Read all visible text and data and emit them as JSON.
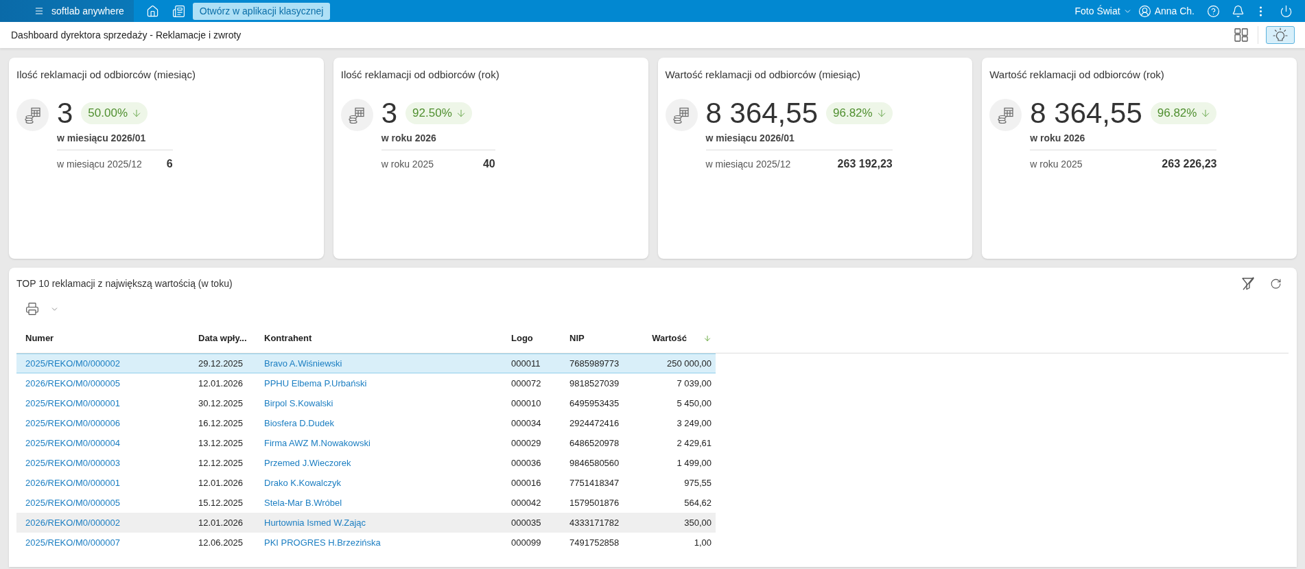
{
  "top_bar": {
    "app_name": "softlab anywhere",
    "open_classic_button": "Otwórz w aplikacji klasycznej",
    "company": "Foto Świat",
    "user": "Anna Ch."
  },
  "page_header": {
    "title": "Dashboard dyrektora sprzedaży - Reklamacje i zwroty",
    "bulb_button": {
      "selected": true
    }
  },
  "kpi_cards": [
    {
      "title": "Ilość reklamacji od odbiorców (miesiąc)",
      "value": "3",
      "change": "50.00%",
      "decreasing": true,
      "period": "w miesiącu 2026/01",
      "previous_period": "w miesiącu 2025/12",
      "previous_value": "6"
    },
    {
      "title": "Ilość reklamacji od odbiorców (rok)",
      "value": "3",
      "change": "92.50%",
      "decreasing": true,
      "period": "w roku 2026",
      "previous_period": "w roku 2025",
      "previous_value": "40"
    },
    {
      "title": "Wartość reklamacji od odbiorców (miesiąc)",
      "value": "8 364,55",
      "change": "96.82%",
      "decreasing": true,
      "period": "w miesiącu 2026/01",
      "previous_period": "w miesiącu 2025/12",
      "previous_value": "263 192,23"
    },
    {
      "title": "Wartość reklamacji od odbiorców (rok)",
      "value": "8 364,55",
      "change": "96.82%",
      "decreasing": true,
      "period": "w roku 2026",
      "previous_period": "w roku 2025",
      "previous_value": "263 226,23"
    }
  ],
  "table": {
    "title": "TOP 10 reklamacji z największą wartością (w toku)",
    "columns": [
      {
        "label": "Numer",
        "kind": "link",
        "sorted": false
      },
      {
        "label": "Data wpły...",
        "kind": "text",
        "sorted": false
      },
      {
        "label": "Kontrahent",
        "kind": "link",
        "sorted": false
      },
      {
        "label": "Logo",
        "kind": "text",
        "sorted": false
      },
      {
        "label": "NIP",
        "kind": "text",
        "sorted": false
      },
      {
        "label": "Wartość",
        "kind": "number",
        "sorted": true
      }
    ],
    "rows": [
      {
        "cells": [
          "2025/REKO/M0/000002",
          "29.12.2025",
          "Bravo A.Wiśniewski",
          "000011",
          "7685989773",
          "250 000,00"
        ],
        "selected": true,
        "hovered": false
      },
      {
        "cells": [
          "2026/REKO/M0/000005",
          "12.01.2026",
          "PPHU Elbema P.Urbański",
          "000072",
          "9818527039",
          "7 039,00"
        ],
        "selected": false,
        "hovered": false
      },
      {
        "cells": [
          "2025/REKO/M0/000001",
          "30.12.2025",
          "Birpol S.Kowalski",
          "000010",
          "6495953435",
          "5 450,00"
        ],
        "selected": false,
        "hovered": false
      },
      {
        "cells": [
          "2025/REKO/M0/000006",
          "16.12.2025",
          "Biosfera D.Dudek",
          "000034",
          "2924472416",
          "3 249,00"
        ],
        "selected": false,
        "hovered": false
      },
      {
        "cells": [
          "2025/REKO/M0/000004",
          "13.12.2025",
          "Firma AWZ M.Nowakowski",
          "000029",
          "6486520978",
          "2 429,61"
        ],
        "selected": false,
        "hovered": false
      },
      {
        "cells": [
          "2025/REKO/M0/000003",
          "12.12.2025",
          "Przemed J.Wieczorek",
          "000036",
          "9846580560",
          "1 499,00"
        ],
        "selected": false,
        "hovered": false
      },
      {
        "cells": [
          "2026/REKO/M0/000001",
          "12.01.2026",
          "Drako K.Kowalczyk",
          "000016",
          "7751418347",
          "975,55"
        ],
        "selected": false,
        "hovered": false
      },
      {
        "cells": [
          "2025/REKO/M0/000005",
          "15.12.2025",
          "Stela-Mar B.Wróbel",
          "000042",
          "1579501876",
          "564,62"
        ],
        "selected": false,
        "hovered": false
      },
      {
        "cells": [
          "2026/REKO/M0/000002",
          "12.01.2026",
          "Hurtownia Ismed W.Zając",
          "000035",
          "4333171782",
          "350,00"
        ],
        "selected": false,
        "hovered": true
      },
      {
        "cells": [
          "2025/REKO/M0/000007",
          "12.06.2025",
          "PKI PROGRES H.Brzezińska",
          "000099",
          "7491752858",
          "1,00"
        ],
        "selected": false,
        "hovered": false
      }
    ]
  }
}
